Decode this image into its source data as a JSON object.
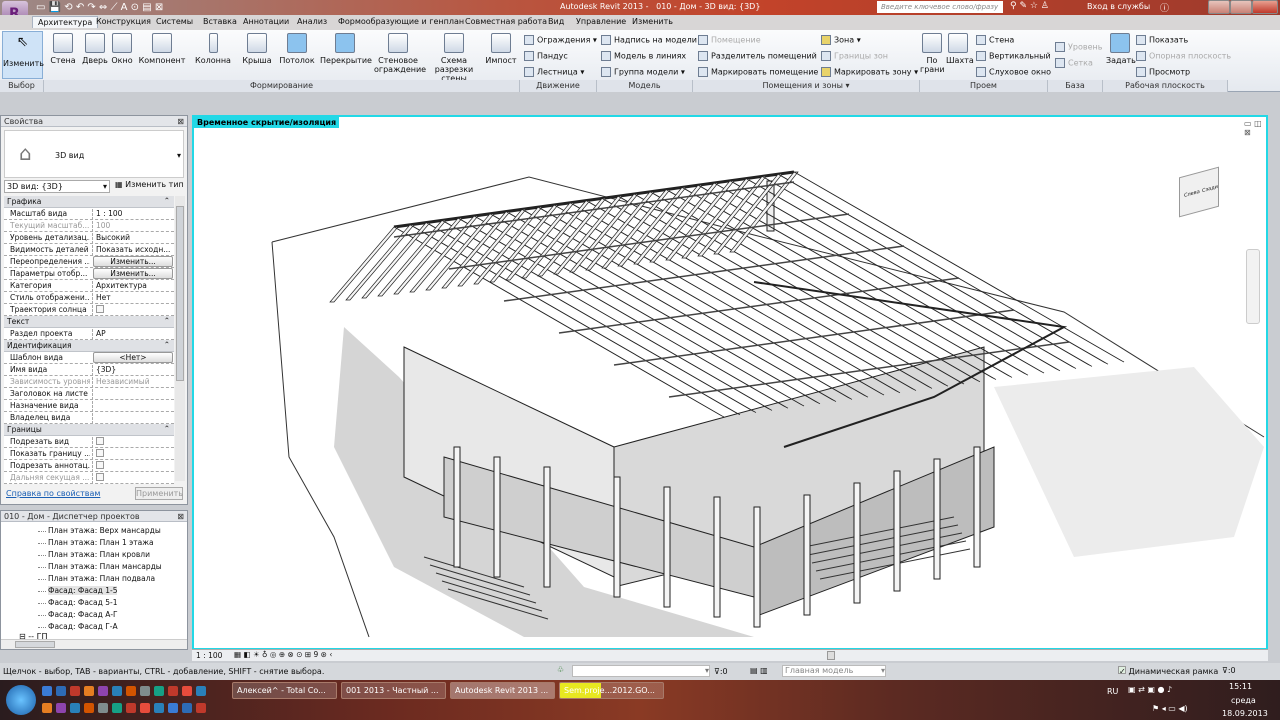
{
  "title_bar": {
    "app": "Autodesk Revit 2013 -",
    "document": "010 - Дом - 3D вид: {3D}",
    "search_placeholder": "Введите ключевое слово/фразу",
    "sign_in": "Вход в службы"
  },
  "tabs": [
    "Архитектура",
    "Конструкция",
    "Системы",
    "Вставка",
    "Аннотации",
    "Анализ",
    "Формообразующие и генплан",
    "Совместная работа",
    "Вид",
    "Управление",
    "Изменить"
  ],
  "ribbon": {
    "modify": "Изменить",
    "groups": [
      "Выбор",
      "Формирование",
      "Движение",
      "Модель",
      "Помещения и зоны",
      "Проем",
      "База",
      "Рабочая плоскость"
    ],
    "build_buttons": [
      "Стена",
      "Дверь",
      "Окно",
      "Компонент",
      "Колонна",
      "Крыша",
      "Потолок",
      "Перекрытие",
      "Стеновое ограждение",
      "Схема разрезки стены",
      "Импост"
    ],
    "circulation": [
      "Ограждения",
      "Пандус",
      "Лестница"
    ],
    "model": [
      "Надпись на модели",
      "Модель в линиях",
      "Группа модели"
    ],
    "room": [
      "Помещение",
      "Разделитель помещений",
      "Маркировать помещение"
    ],
    "area": [
      "Зона",
      "Границы зон",
      "Маркировать зону"
    ],
    "opening": {
      "by_face": "По грани",
      "shaft": "Шахта",
      "wall": "Стена",
      "vertical": "Вертикальный",
      "dormer": "Слуховое окно"
    },
    "datum": [
      "Уровень",
      "Сетка"
    ],
    "workplane": {
      "set": "Задать",
      "show": "Показать",
      "ref_plane": "Опорная плоскость",
      "viewer": "Просмотр"
    }
  },
  "properties": {
    "title": "Свойства",
    "type_name": "3D вид",
    "selector": "3D вид: {3D}",
    "edit_type": "Изменить тип",
    "rows": [
      {
        "k": "Графика",
        "section": true
      },
      {
        "k": "Масштаб вида",
        "v": "1 : 100"
      },
      {
        "k": "Текущий масштаб...",
        "v": "100",
        "grey": true
      },
      {
        "k": "Уровень детализац...",
        "v": "Высокий"
      },
      {
        "k": "Видимость деталей",
        "v": "Показать исходн..."
      },
      {
        "k": "Переопределения ...",
        "btn": "Изменить..."
      },
      {
        "k": "Параметры отобр...",
        "btn": "Изменить..."
      },
      {
        "k": "Категория",
        "v": "Архитектура"
      },
      {
        "k": "Стиль отображени...",
        "v": "Нет"
      },
      {
        "k": "Траектория солнца",
        "check": true
      },
      {
        "k": "Текст",
        "section": true
      },
      {
        "k": "Раздел проекта",
        "v": "АР"
      },
      {
        "k": "Идентификация",
        "section": true
      },
      {
        "k": "Шаблон вида",
        "btn": "<Нет>"
      },
      {
        "k": "Имя вида",
        "v": "{3D}"
      },
      {
        "k": "Зависимость уровня",
        "v": "Независимый",
        "grey": true
      },
      {
        "k": "Заголовок на листе",
        "v": ""
      },
      {
        "k": "Назначение вида",
        "v": ""
      },
      {
        "k": "Владелец вида",
        "v": ""
      },
      {
        "k": "Границы",
        "section": true
      },
      {
        "k": "Подрезать вид",
        "check": true
      },
      {
        "k": "Показать границу ...",
        "check": true
      },
      {
        "k": "Подрезать аннотац...",
        "check": true
      },
      {
        "k": "Дальняя секущая ...",
        "check": true,
        "grey": true
      }
    ],
    "help_link": "Справка по свойствам",
    "apply": "Применить"
  },
  "browser": {
    "title": "010 - Дом - Диспетчер проектов",
    "items": [
      "План этажа: Верх мансарды",
      "План этажа: План 1 этажа",
      "План этажа: План кровли",
      "План этажа: План мансарды",
      "План этажа: План подвала",
      "Фасад: Фасад 1-5",
      "Фасад: Фасад 5-1",
      "Фасад: Фасад А-Г",
      "Фасад: Фасад Г-А"
    ],
    "selected": 5,
    "node": "ГП"
  },
  "viewport": {
    "label": "Временное скрытие/изоляция",
    "scale": "1 : 100",
    "viewcube": [
      "Слева",
      "Сзади"
    ]
  },
  "status": {
    "hint": "Щелчок - выбор, TAB - варианты, CTRL - добавление, SHIFT - снятие выбора.",
    "count1": ":0",
    "model": "Главная модель",
    "dynamic": "Динамическая рамка",
    "filter": ":0"
  },
  "taskbar": {
    "tasks": [
      "Алексей^ - Total Co...",
      "001 2013 - Частный ...",
      "Autodesk Revit 2013 ...",
      "Sem.proje...2012.GO..."
    ],
    "lang": "RU",
    "time": "15:11",
    "day": "среда",
    "date": "18.09.2013"
  }
}
